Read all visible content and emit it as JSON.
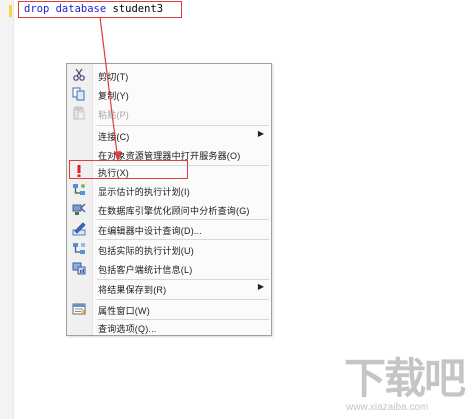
{
  "editor": {
    "code_keyword": "drop database",
    "code_identifier": " student3"
  },
  "context_menu": {
    "items": [
      {
        "label": "剪切(T)",
        "icon": "scissors-icon",
        "disabled": false,
        "submenu": false
      },
      {
        "label": "复制(Y)",
        "icon": "copy-icon",
        "disabled": false,
        "submenu": false
      },
      {
        "label": "粘贴(P)",
        "icon": "paste-icon",
        "disabled": true,
        "submenu": false
      },
      {
        "label": "连接(C)",
        "icon": "",
        "disabled": false,
        "submenu": true
      },
      {
        "label": "在对象资源管理器中打开服务器(O)",
        "icon": "",
        "disabled": false,
        "submenu": false
      },
      {
        "label": "执行(X)",
        "icon": "execute-icon",
        "disabled": false,
        "submenu": false
      },
      {
        "label": "显示估计的执行计划(I)",
        "icon": "estimated-plan-icon",
        "disabled": false,
        "submenu": false
      },
      {
        "label": "在数据库引擎优化顾问中分析查询(G)",
        "icon": "tuning-advisor-icon",
        "disabled": false,
        "submenu": false
      },
      {
        "label": "在编辑器中设计查询(D)...",
        "icon": "design-query-icon",
        "disabled": false,
        "submenu": false
      },
      {
        "label": "包括实际的执行计划(U)",
        "icon": "actual-plan-icon",
        "disabled": false,
        "submenu": false
      },
      {
        "label": "包括客户端统计信息(L)",
        "icon": "client-stats-icon",
        "disabled": false,
        "submenu": false
      },
      {
        "label": "将结果保存到(R)",
        "icon": "",
        "disabled": false,
        "submenu": true
      },
      {
        "label": "属性窗口(W)",
        "icon": "properties-icon",
        "disabled": false,
        "submenu": false
      },
      {
        "label": "查询选项(Q)...",
        "icon": "",
        "disabled": false,
        "submenu": false
      }
    ],
    "submenu_arrow": "▶"
  },
  "watermark": {
    "text": "下载吧",
    "url": "www.xiazaiba.com"
  },
  "colors": {
    "annotation": "#e23c3c",
    "keyword": "#1f1fcf"
  }
}
